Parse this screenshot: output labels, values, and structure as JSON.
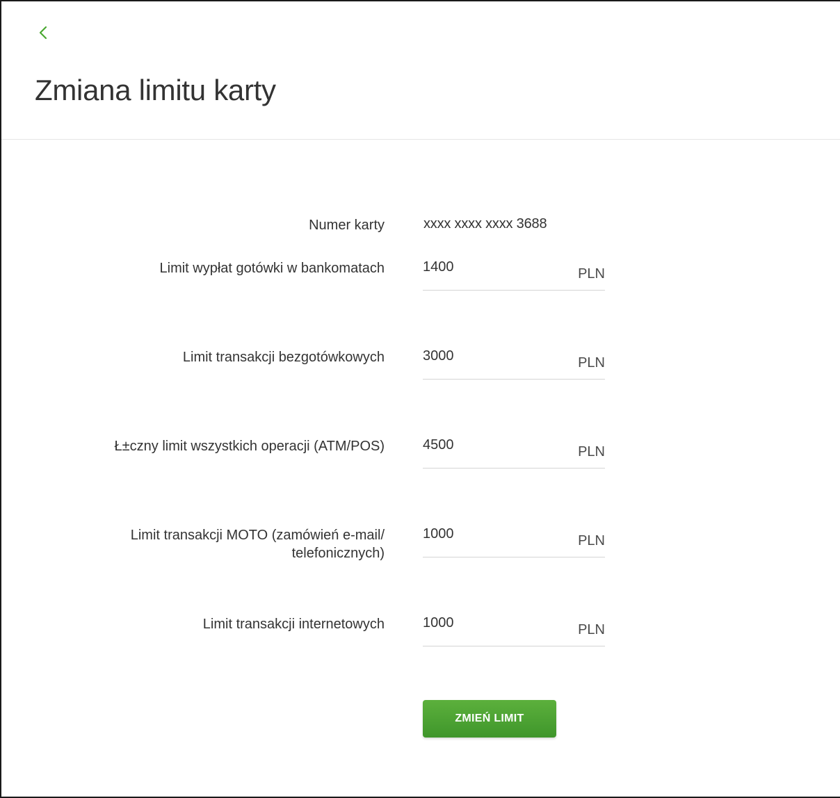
{
  "header": {
    "back_icon": "chevron-left-icon",
    "title": "Zmiana limitu karty",
    "accent_color": "#4aa832"
  },
  "form": {
    "card_number": {
      "label": "Numer karty",
      "value": "xxxx xxxx xxxx 3688"
    },
    "limits": [
      {
        "label": "Limit wypłat gotówki w bankomatach",
        "value": "1400",
        "currency": "PLN"
      },
      {
        "label": "Limit transakcji bezgotówkowych",
        "value": "3000",
        "currency": "PLN"
      },
      {
        "label": "Ł±czny limit wszystkich operacji (ATM/POS)",
        "value": "4500",
        "currency": "PLN"
      },
      {
        "label": "Limit transakcji MOTO (zamówień e-mail/ telefonicznych)",
        "value": "1000",
        "currency": "PLN"
      },
      {
        "label": "Limit transakcji internetowych",
        "value": "1000",
        "currency": "PLN"
      }
    ],
    "submit_label": "ZMIEŃ LIMIT"
  }
}
